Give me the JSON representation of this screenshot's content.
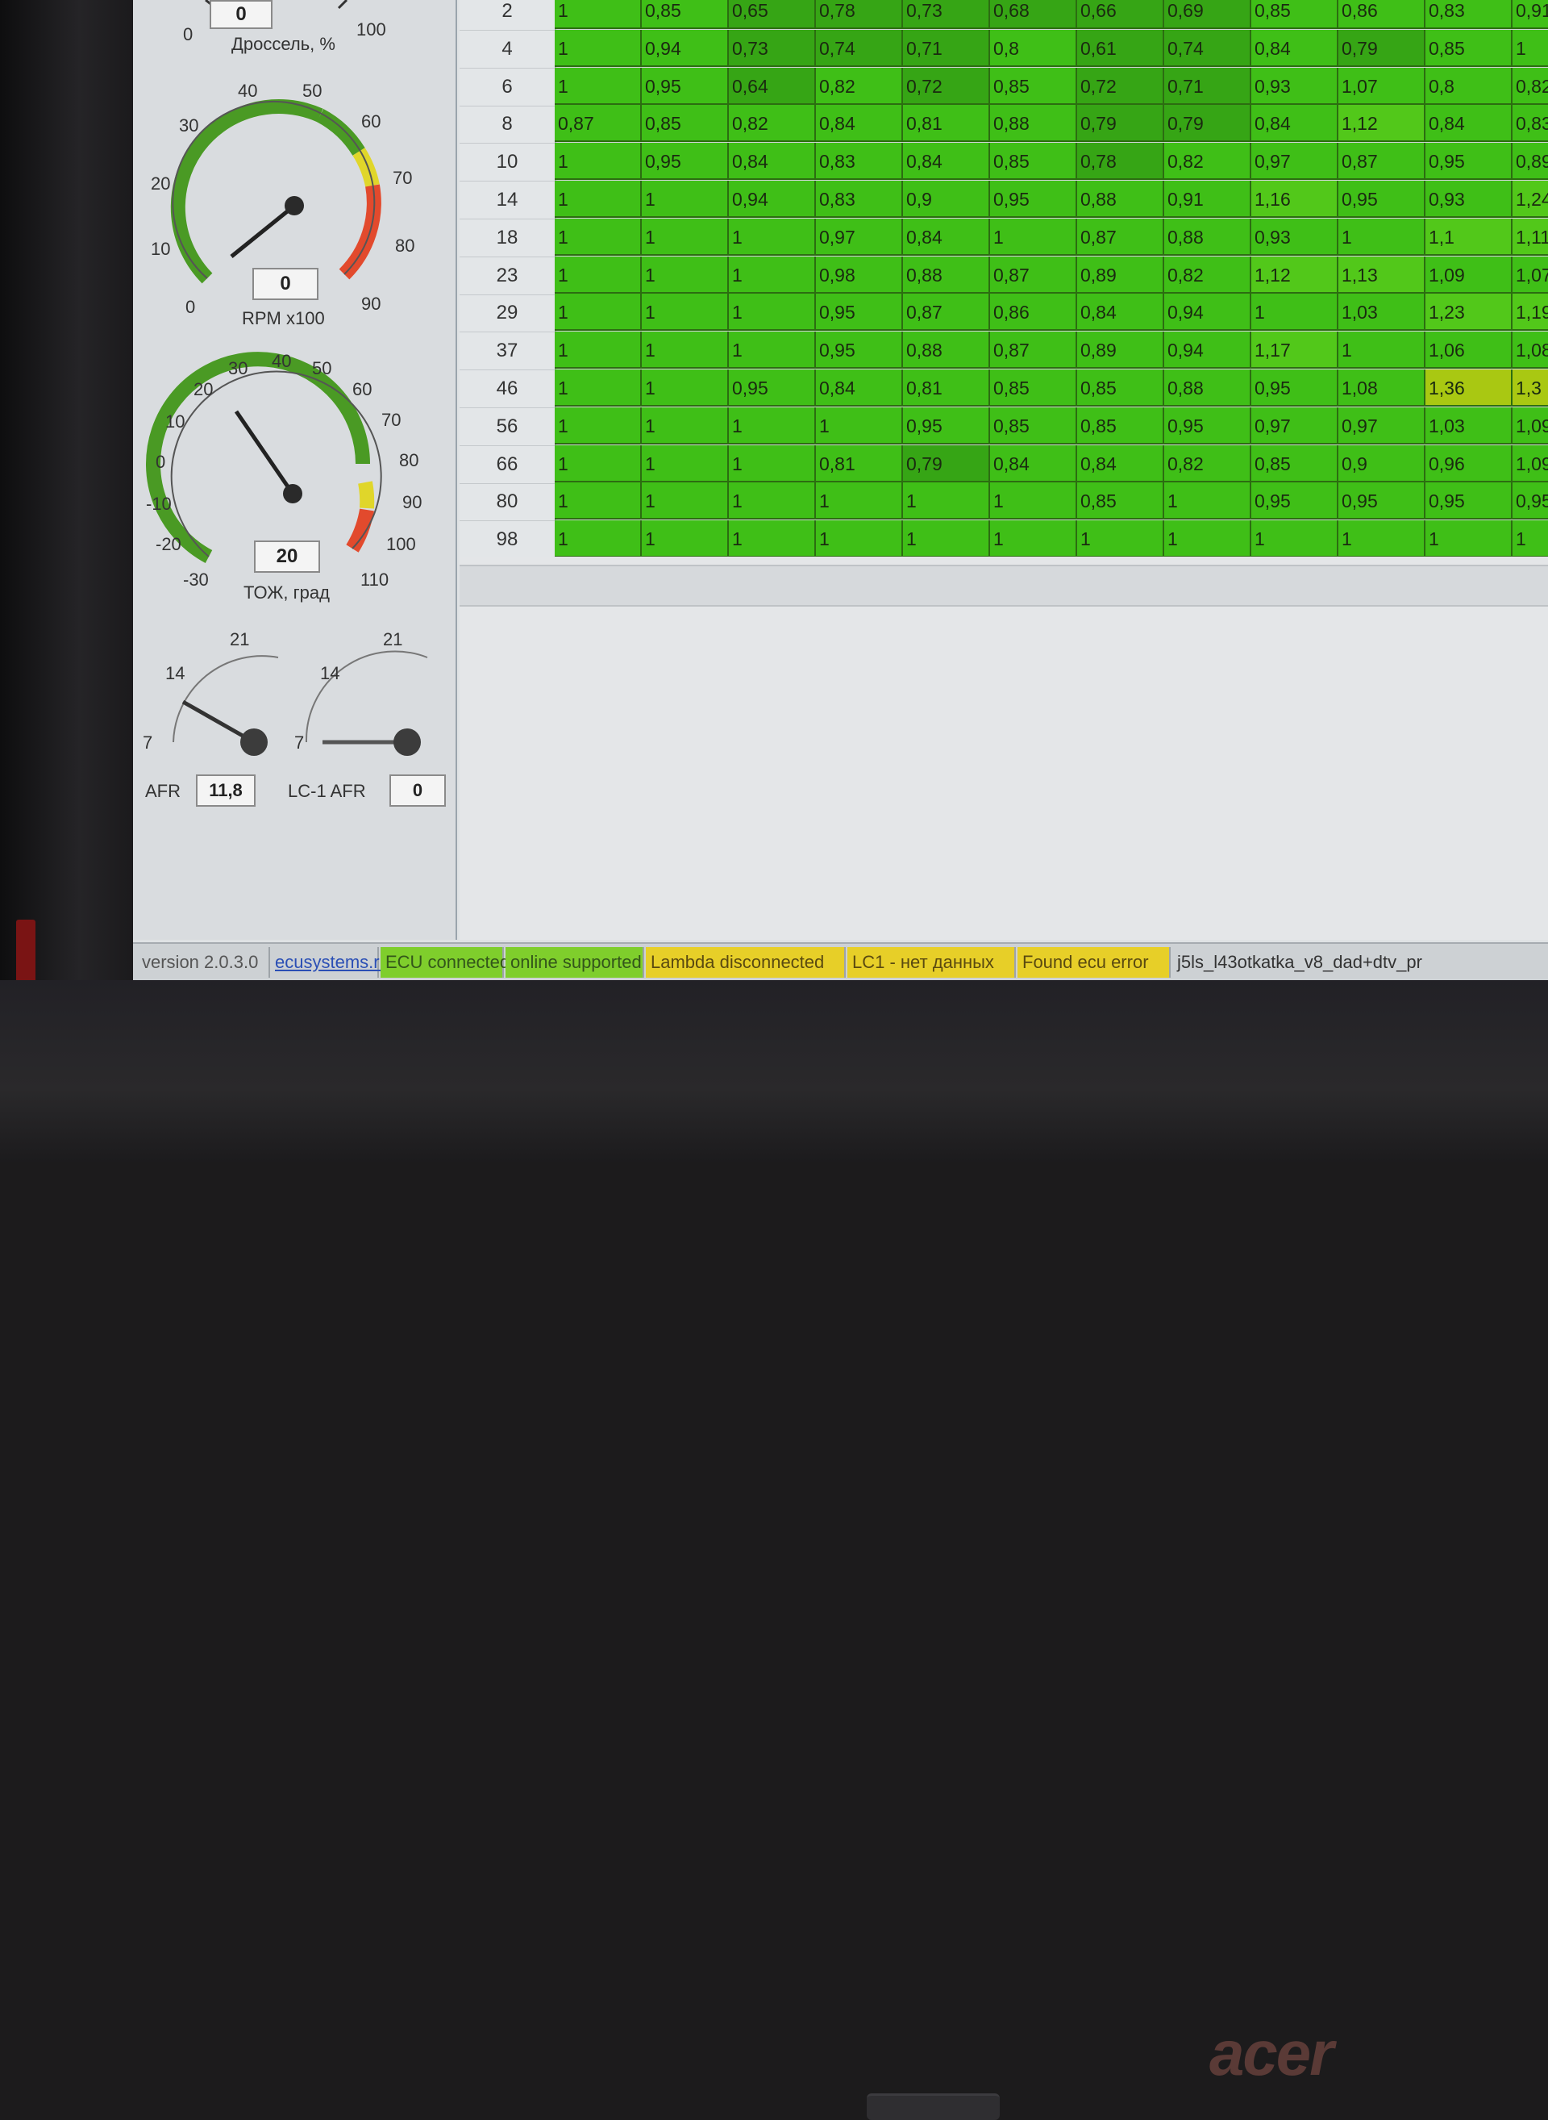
{
  "gauges": {
    "throttle": {
      "value": "0",
      "label": "Дроссель, %",
      "min_label": "0",
      "max_label": "100"
    },
    "rpm": {
      "value": "0",
      "label": "RPM x100",
      "ticks": [
        "0",
        "10",
        "20",
        "30",
        "40",
        "50",
        "60",
        "70",
        "80",
        "90"
      ]
    },
    "coolant": {
      "value": "20",
      "label": "ТОЖ, град",
      "ticks": [
        "-30",
        "-20",
        "-10",
        "0",
        "10",
        "20",
        "30",
        "40",
        "50",
        "60",
        "70",
        "80",
        "90",
        "100",
        "110"
      ]
    },
    "afr": {
      "label": "AFR",
      "value": "11,8",
      "ticks": [
        "7",
        "14",
        "21"
      ]
    },
    "lc1_afr": {
      "label": "LC-1 AFR",
      "value": "0",
      "ticks": [
        "7",
        "14",
        "21"
      ]
    }
  },
  "table": {
    "row_headers": [
      "2",
      "4",
      "6",
      "8",
      "10",
      "14",
      "18",
      "23",
      "29",
      "37",
      "46",
      "56",
      "66",
      "80",
      "98"
    ],
    "rows": [
      [
        "1",
        "0,85",
        "0,65",
        "0,78",
        "0,73",
        "0,68",
        "0,66",
        "0,69",
        "0,85",
        "0,86",
        "0,83",
        "0,91"
      ],
      [
        "1",
        "0,94",
        "0,73",
        "0,74",
        "0,71",
        "0,8",
        "0,61",
        "0,74",
        "0,84",
        "0,79",
        "0,85",
        "1"
      ],
      [
        "1",
        "0,95",
        "0,64",
        "0,82",
        "0,72",
        "0,85",
        "0,72",
        "0,71",
        "0,93",
        "1,07",
        "0,8",
        "0,82"
      ],
      [
        "0,87",
        "0,85",
        "0,82",
        "0,84",
        "0,81",
        "0,88",
        "0,79",
        "0,79",
        "0,84",
        "1,12",
        "0,84",
        "0,83"
      ],
      [
        "1",
        "0,95",
        "0,84",
        "0,83",
        "0,84",
        "0,85",
        "0,78",
        "0,82",
        "0,97",
        "0,87",
        "0,95",
        "0,89"
      ],
      [
        "1",
        "1",
        "0,94",
        "0,83",
        "0,9",
        "0,95",
        "0,88",
        "0,91",
        "1,16",
        "0,95",
        "0,93",
        "1,24"
      ],
      [
        "1",
        "1",
        "1",
        "0,97",
        "0,84",
        "1",
        "0,87",
        "0,88",
        "0,93",
        "1",
        "1,1",
        "1,11"
      ],
      [
        "1",
        "1",
        "1",
        "0,98",
        "0,88",
        "0,87",
        "0,89",
        "0,82",
        "1,12",
        "1,13",
        "1,09",
        "1,07"
      ],
      [
        "1",
        "1",
        "1",
        "0,95",
        "0,87",
        "0,86",
        "0,84",
        "0,94",
        "1",
        "1,03",
        "1,23",
        "1,19"
      ],
      [
        "1",
        "1",
        "1",
        "0,95",
        "0,88",
        "0,87",
        "0,89",
        "0,94",
        "1,17",
        "1",
        "1,06",
        "1,08"
      ],
      [
        "1",
        "1",
        "0,95",
        "0,84",
        "0,81",
        "0,85",
        "0,85",
        "0,88",
        "0,95",
        "1,08",
        "1,36",
        "1,3"
      ],
      [
        "1",
        "1",
        "1",
        "1",
        "0,95",
        "0,85",
        "0,85",
        "0,95",
        "0,97",
        "0,97",
        "1,03",
        "1,09"
      ],
      [
        "1",
        "1",
        "1",
        "0,81",
        "0,79",
        "0,84",
        "0,84",
        "0,82",
        "0,85",
        "0,9",
        "0,96",
        "1,09"
      ],
      [
        "1",
        "1",
        "1",
        "1",
        "1",
        "1",
        "0,85",
        "1",
        "0,95",
        "0,95",
        "0,95",
        "0,95"
      ],
      [
        "1",
        "1",
        "1",
        "1",
        "1",
        "1",
        "1",
        "1",
        "1",
        "1",
        "1",
        "1"
      ]
    ]
  },
  "status_bar": {
    "version": "version 2.0.3.0",
    "website": "ecusystems.ru",
    "ecu": "ECU connected",
    "online": "online supported",
    "lambda": "Lambda disconnected",
    "lc1": "LC1 - нет данных",
    "error": "Found ecu error",
    "file": "j5ls_l43otkatka_v8_dad+dtv_pr"
  },
  "laptop_brand": "acer",
  "colors": {
    "cell_green": "#3fbf17",
    "cell_high": "#a9c812",
    "status_green": "#7fce2c",
    "status_yellow": "#e7cf28"
  }
}
